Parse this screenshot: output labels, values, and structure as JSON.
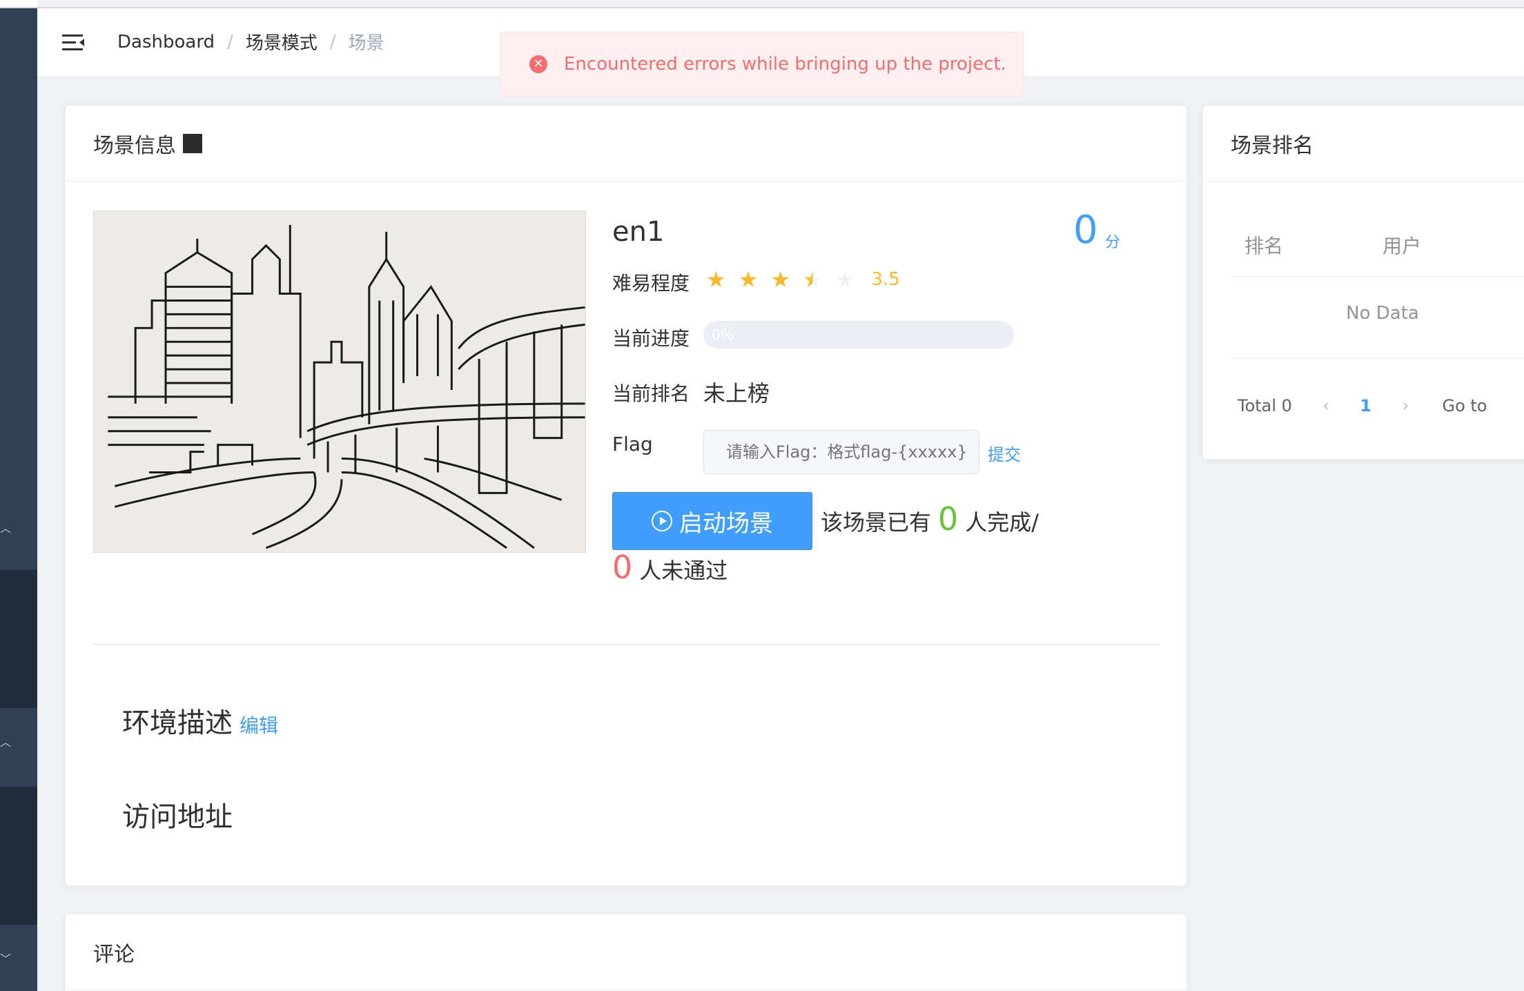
{
  "breadcrumb": {
    "items": [
      "Dashboard",
      "场景模式",
      "场景"
    ]
  },
  "alert": {
    "message": "Encountered errors while bringing up the project."
  },
  "info_card": {
    "title": "场景信息",
    "scene_name": "en1",
    "score": "0",
    "score_unit": "分",
    "difficulty_label": "难易程度",
    "difficulty_value": 3.5,
    "difficulty_text": "3.5",
    "progress_label": "当前进度",
    "progress_percent": 0,
    "progress_text": "0%",
    "rank_label": "当前排名",
    "rank_value": "未上榜",
    "flag_label": "Flag",
    "flag_placeholder": "请输入Flag：格式flag-{xxxxx}",
    "submit_label": "提交",
    "start_button": "启动场景",
    "completed_prefix": "该场景已有",
    "completed_count": "0",
    "completed_suffix": "人完成/",
    "failed_count": "0",
    "failed_suffix": "人未通过",
    "env_desc_title": "环境描述",
    "edit_label": "编辑",
    "access_title": "访问地址"
  },
  "rank_card": {
    "title": "场景排名",
    "columns": [
      "排名",
      "用户"
    ],
    "empty_text": "No Data",
    "total_text": "Total 0",
    "current_page": "1",
    "goto_text": "Go to"
  },
  "comment_card": {
    "title": "评论"
  },
  "colors": {
    "primary": "#409eff",
    "success": "#67c23a",
    "danger": "#f56c6c",
    "star": "#f7ba2a",
    "sidebar": "#304156"
  }
}
